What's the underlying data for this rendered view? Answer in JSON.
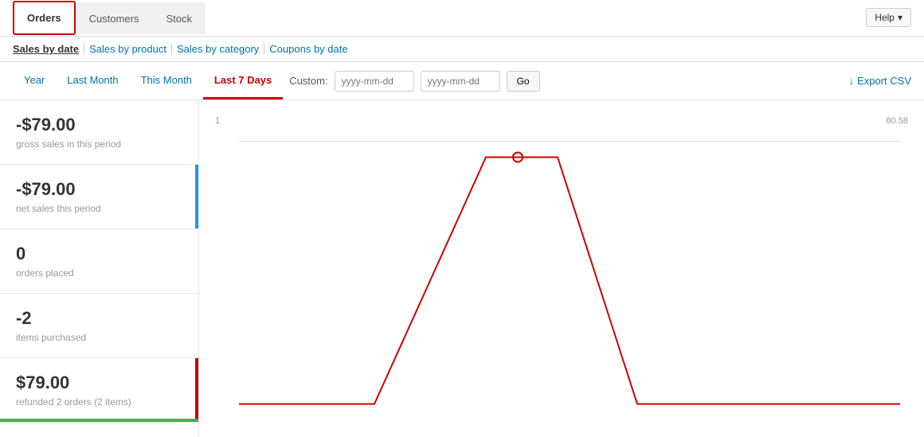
{
  "top": {
    "help_label": "Help",
    "help_arrow": "▾"
  },
  "nav": {
    "tabs": [
      {
        "id": "orders",
        "label": "Orders",
        "active": true
      },
      {
        "id": "customers",
        "label": "Customers",
        "active": false
      },
      {
        "id": "stock",
        "label": "Stock",
        "active": false
      }
    ]
  },
  "sub_nav": {
    "links": [
      {
        "id": "sales-by-date",
        "label": "Sales by date",
        "active": true
      },
      {
        "id": "sales-by-product",
        "label": "Sales by product",
        "active": false
      },
      {
        "id": "sales-by-category",
        "label": "Sales by category",
        "active": false
      },
      {
        "id": "coupons-by-date",
        "label": "Coupons by date",
        "active": false
      }
    ]
  },
  "filter": {
    "tabs": [
      {
        "id": "year",
        "label": "Year",
        "active": false
      },
      {
        "id": "last-month",
        "label": "Last Month",
        "active": false
      },
      {
        "id": "this-month",
        "label": "This Month",
        "active": false
      },
      {
        "id": "last-7-days",
        "label": "Last 7 Days",
        "active": true
      }
    ],
    "custom_label": "Custom:",
    "date_from_placeholder": "yyyy-mm-dd",
    "date_to_placeholder": "yyyy-mm-dd",
    "go_label": "Go",
    "export_label": "Export CSV",
    "export_icon": "↓"
  },
  "stats": [
    {
      "id": "gross-sales",
      "value": "-$79.00",
      "label": "gross sales in this period",
      "accent_color": ""
    },
    {
      "id": "net-sales",
      "value": "-$79.00",
      "label": "net sales this period",
      "accent_color": "#2196f3"
    },
    {
      "id": "orders-placed",
      "value": "0",
      "label": "orders placed",
      "accent_color": ""
    },
    {
      "id": "items-purchased",
      "value": "-2",
      "label": "items purchased",
      "accent_color": ""
    },
    {
      "id": "refunded",
      "value": "$79.00",
      "label": "refunded 2 orders (2 items)",
      "accent_color": "#c00"
    }
  ],
  "chart": {
    "y_left": "1",
    "y_right": "80.58"
  }
}
